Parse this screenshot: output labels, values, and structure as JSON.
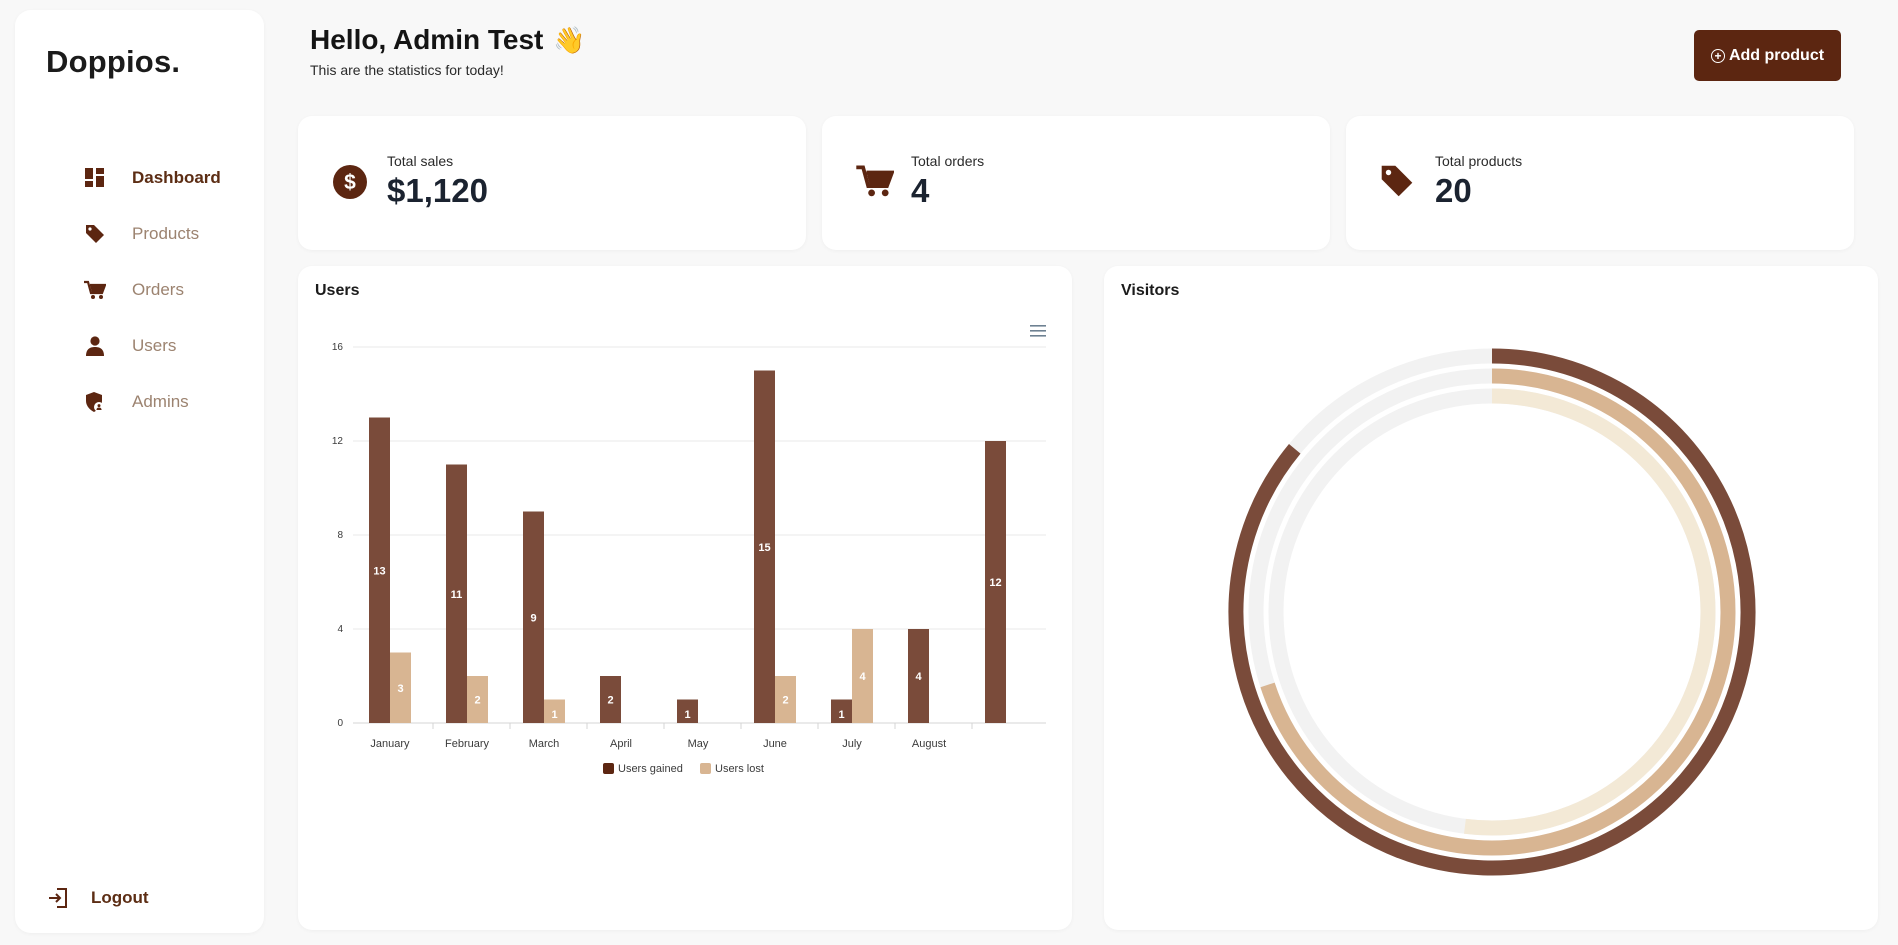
{
  "sidebar": {
    "brand": "Doppios.",
    "items": [
      {
        "label": "Dashboard",
        "icon": "dashboard-icon",
        "active": true
      },
      {
        "label": "Products",
        "icon": "tag-icon",
        "active": false
      },
      {
        "label": "Orders",
        "icon": "cart-icon",
        "active": false
      },
      {
        "label": "Users",
        "icon": "user-icon",
        "active": false
      },
      {
        "label": "Admins",
        "icon": "shield-user-icon",
        "active": false
      }
    ],
    "logout_label": "Logout"
  },
  "header": {
    "title": "Hello, Admin Test",
    "title_emoji": "👋",
    "subtitle": "This are the statistics for today!",
    "add_button_label": "Add product"
  },
  "stats": [
    {
      "label": "Total sales",
      "value": "$1,120",
      "icon": "dollar-circle-icon"
    },
    {
      "label": "Total orders",
      "value": "4",
      "icon": "cart-icon"
    },
    {
      "label": "Total products",
      "value": "20",
      "icon": "tag-icon"
    }
  ],
  "panels": {
    "users_title": "Users",
    "visitors_title": "Visitors"
  },
  "colors": {
    "brand": "#5c2611",
    "gained": "#7a4b3a",
    "lost": "#d8b592",
    "pale": "#f3e9d6",
    "track": "#f2f2f2"
  },
  "chart_data": [
    {
      "type": "bar",
      "categories": [
        "January",
        "February",
        "March",
        "April",
        "May",
        "June",
        "July",
        "August",
        ""
      ],
      "series": [
        {
          "name": "Users gained",
          "values": [
            13,
            11,
            9,
            2,
            1,
            15,
            1,
            4,
            12
          ]
        },
        {
          "name": "Users lost",
          "values": [
            3,
            2,
            1,
            0,
            0,
            2,
            4,
            0,
            0
          ]
        }
      ],
      "y_ticks": [
        0,
        4,
        8,
        12,
        16
      ],
      "ylim": [
        0,
        16
      ],
      "grid": true,
      "legend": "bottom"
    },
    {
      "type": "radialBar",
      "series": [
        {
          "name": "",
          "value": 86
        },
        {
          "name": "",
          "value": 70
        },
        {
          "name": "",
          "value": 52
        }
      ],
      "max": 100
    }
  ]
}
